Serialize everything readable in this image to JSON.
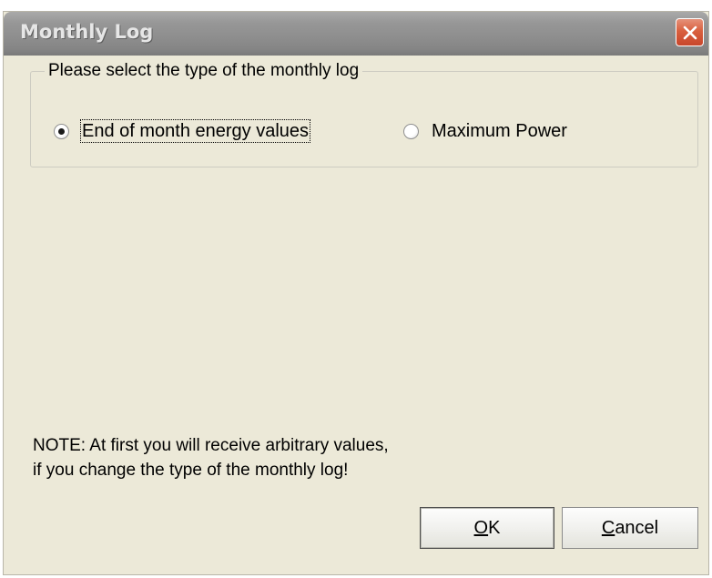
{
  "window": {
    "title": "Monthly Log"
  },
  "group": {
    "label": "Please select the type of the monthly log",
    "options": [
      {
        "label": "End of month energy values",
        "selected": true
      },
      {
        "label": "Maximum Power",
        "selected": false
      }
    ]
  },
  "note": {
    "line1": "NOTE: At first you will receive arbitrary values,",
    "line2": "if you change the type of the monthly log!"
  },
  "buttons": {
    "ok": {
      "mnemonic": "O",
      "rest": "K"
    },
    "cancel": {
      "mnemonic": "C",
      "rest": "ancel"
    }
  },
  "colors": {
    "titlebar": "#8f8f8f",
    "close": "#d9603f",
    "background": "#ece9d8"
  }
}
